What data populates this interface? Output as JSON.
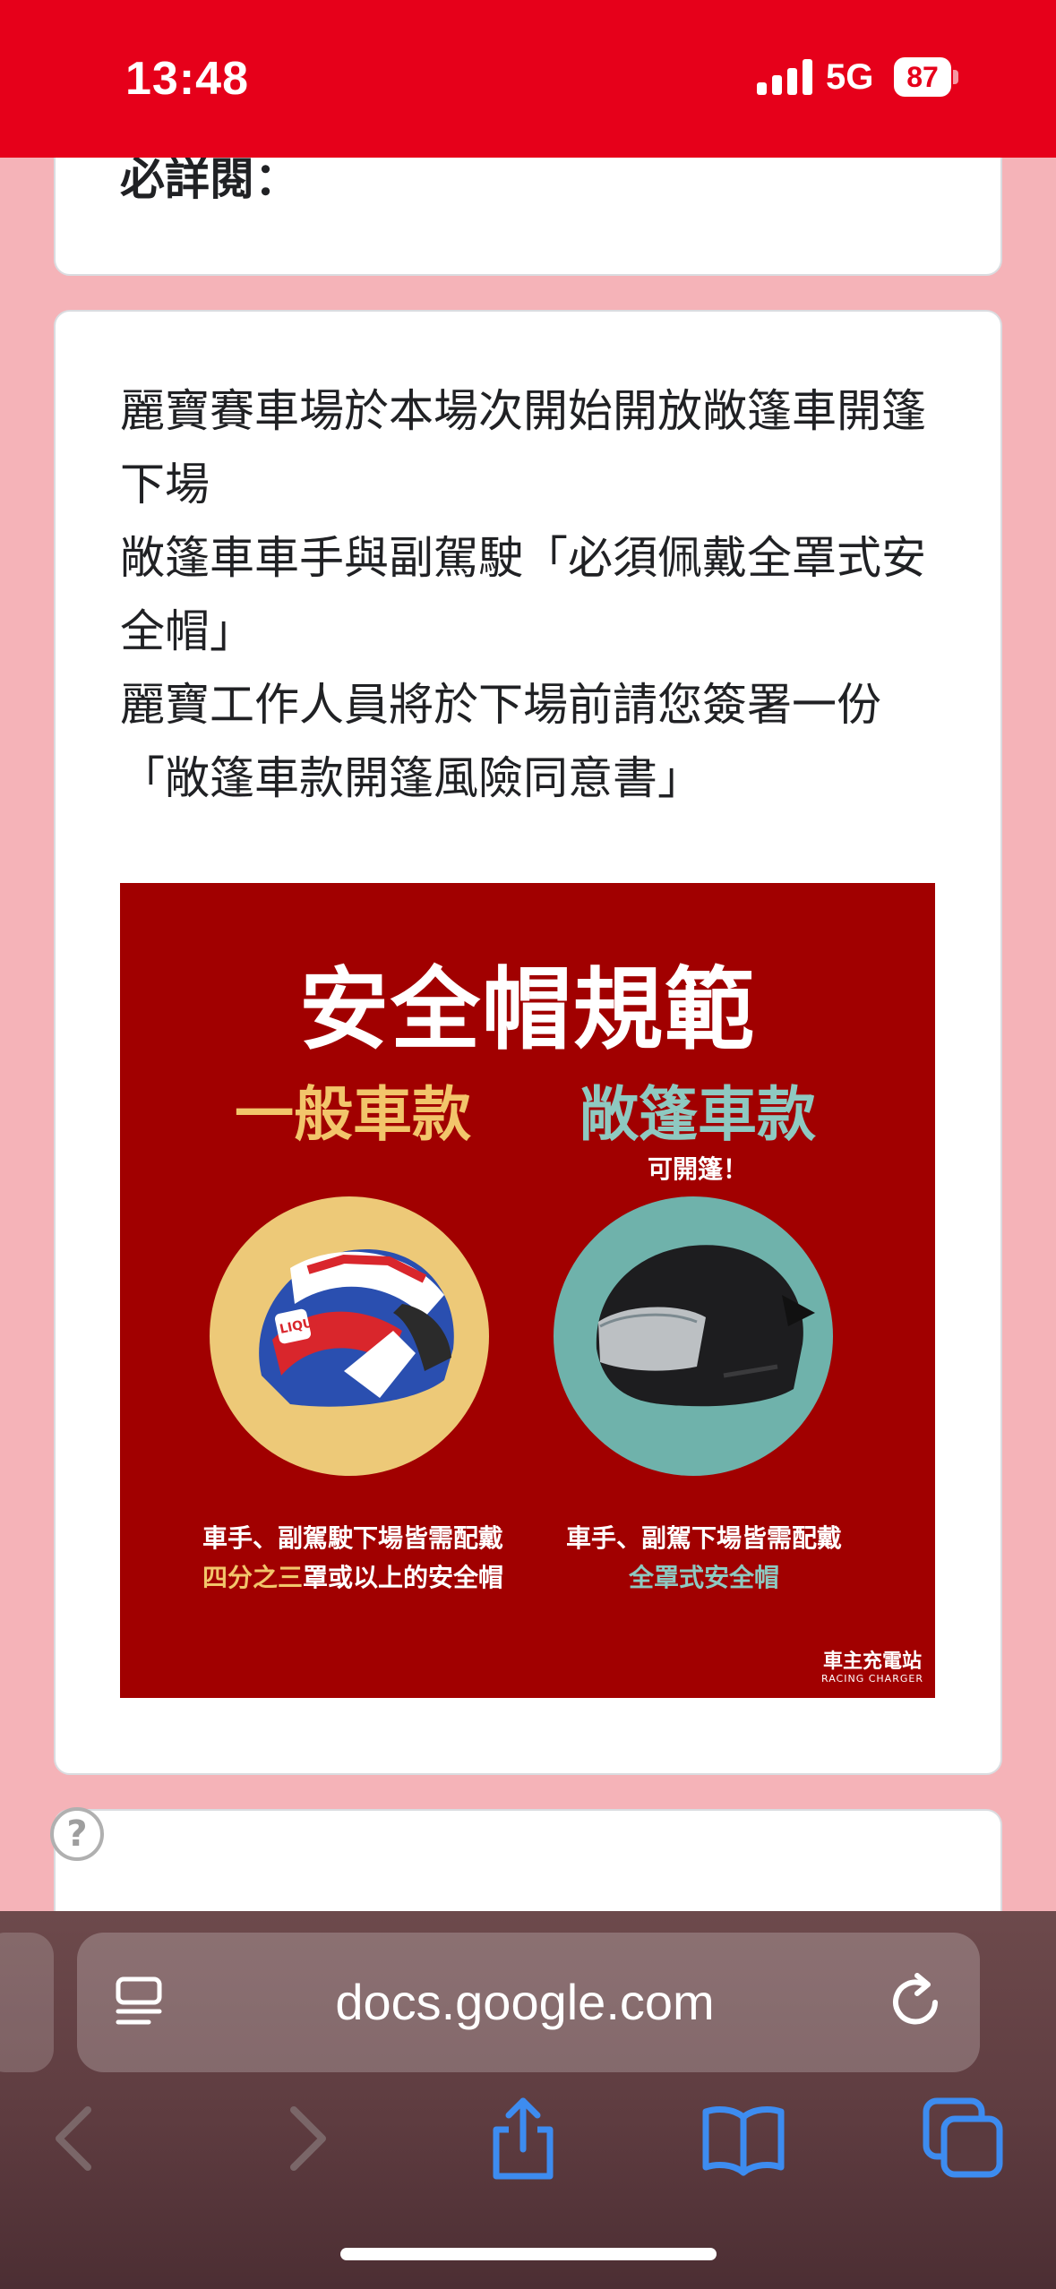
{
  "status_bar": {
    "time": "13:48",
    "network": "5G",
    "battery": "87",
    "background_color": "#e6001a"
  },
  "form": {
    "cut_heading": "必詳閱：",
    "description_lines": [
      "麗寶賽車場於本場次開始開放敞篷車開篷下場",
      "敞篷車車手與副駕駛「必須佩戴全罩式安全帽」",
      "麗寶工作人員將於下場前請您簽署一份「敞篷車款開篷風險同意書」"
    ],
    "poster": {
      "title": "安全帽規範",
      "left_column": {
        "title": "一般車款",
        "caption_line1": "車手、副駕駛下場皆需配戴",
        "caption_highlight": "四分之三",
        "caption_rest": "罩或以上的安全帽"
      },
      "right_column": {
        "title": "敞篷車款",
        "note": "可開篷！",
        "caption_line1": "車手、副駕下場皆需配戴",
        "caption_highlight": "全罩式安全帽"
      },
      "brand": {
        "zh": "車主充電站",
        "en": "RACING CHARGER"
      },
      "colors": {
        "background": "#a10000",
        "gold": "#f2c56b",
        "teal": "#8ec9c1"
      }
    },
    "help_icon": "?"
  },
  "browser": {
    "url": "docs.google.com",
    "icons": [
      "reader-icon",
      "reload-icon",
      "back-icon",
      "forward-icon",
      "share-icon",
      "bookmarks-icon",
      "tabs-icon"
    ]
  }
}
